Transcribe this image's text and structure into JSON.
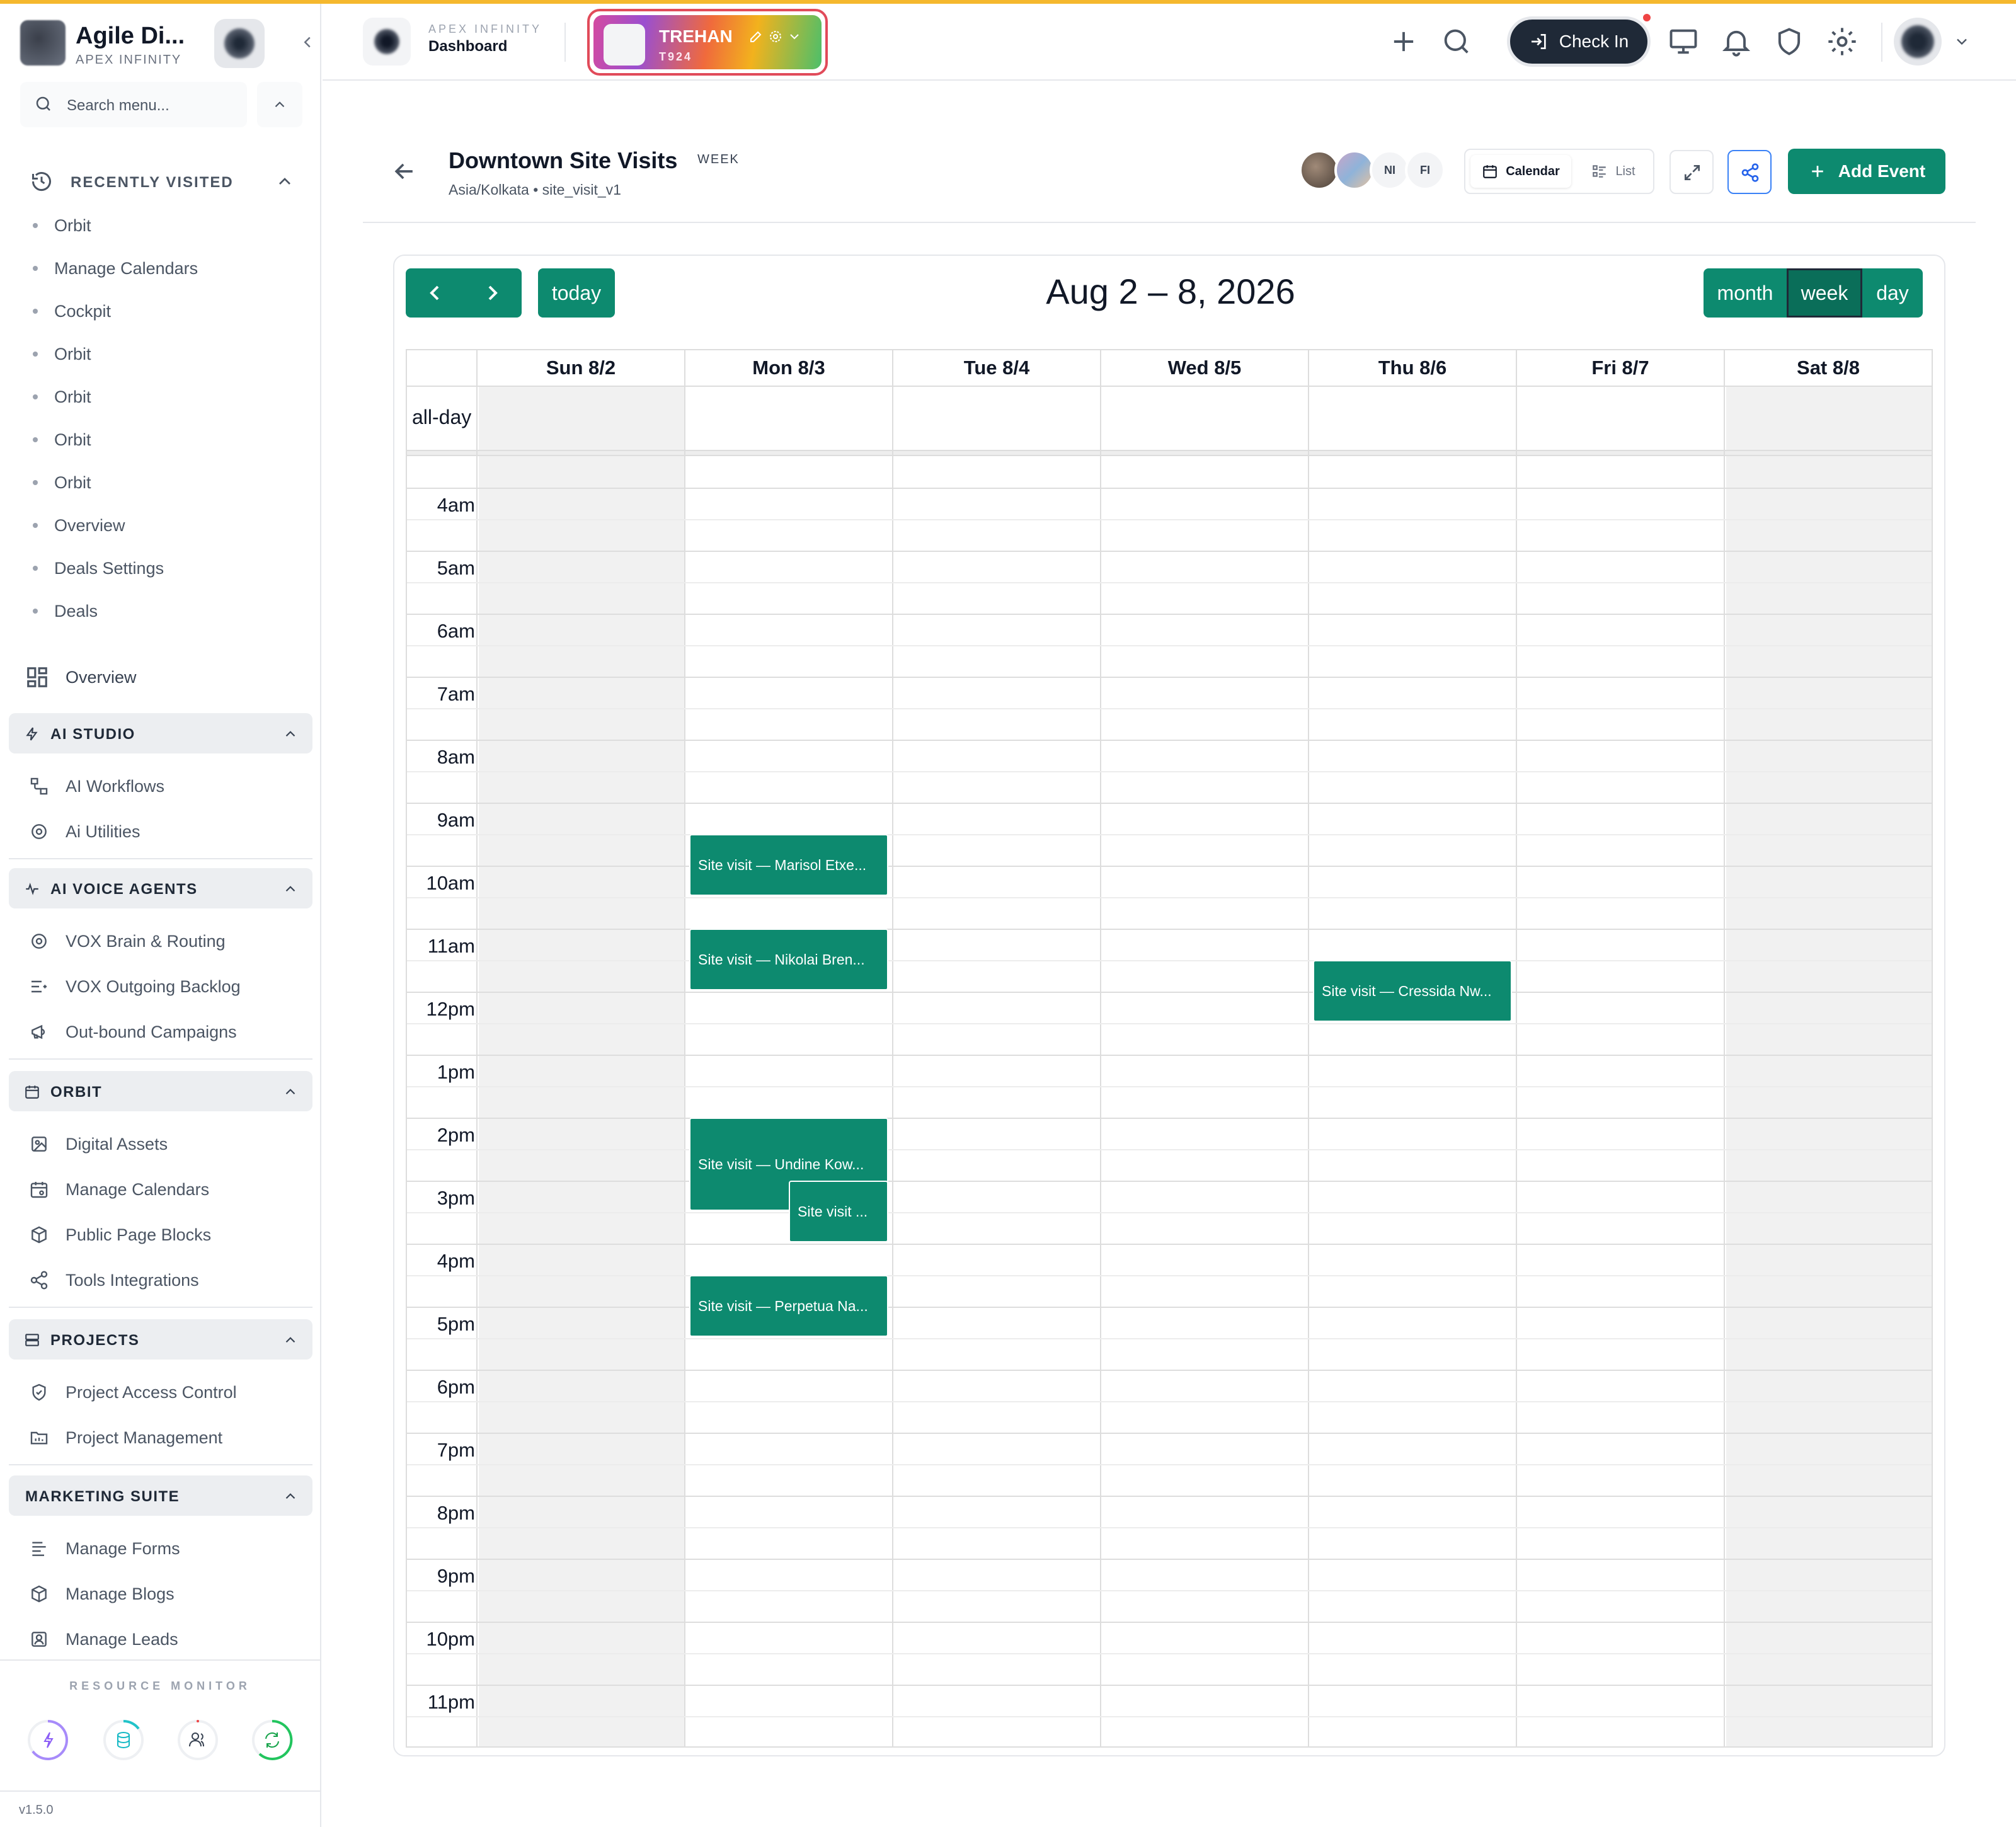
{
  "sidebar": {
    "brand_name": "Agile Di...",
    "brand_sub": "APEX INFINITY",
    "search_placeholder": "Search menu...",
    "recently_visited_label": "RECENTLY VISITED",
    "recently_visited": [
      "Orbit",
      "Manage Calendars",
      "Cockpit",
      "Orbit",
      "Orbit",
      "Orbit",
      "Orbit",
      "Overview",
      "Deals Settings",
      "Deals"
    ],
    "overview_label": "Overview",
    "groups": [
      {
        "label": "AI STUDIO",
        "items": [
          "AI Workflows",
          "Ai Utilities"
        ]
      },
      {
        "label": "AI VOICE AGENTS",
        "items": [
          "VOX Brain & Routing",
          "VOX Outgoing Backlog",
          "Out-bound Campaigns"
        ]
      },
      {
        "label": "ORBIT",
        "items": [
          "Digital Assets",
          "Manage Calendars",
          "Public Page Blocks",
          "Tools Integrations"
        ]
      },
      {
        "label": "PROJECTS",
        "items": [
          "Project Access Control",
          "Project Management"
        ]
      },
      {
        "label": "MARKETING SUITE",
        "items": [
          "Manage Forms",
          "Manage Blogs",
          "Manage Leads"
        ]
      }
    ],
    "resource_monitor_label": "RESOURCE MONITOR",
    "version": "v1.5.0"
  },
  "header": {
    "workspace_sub": "APEX INFINITY",
    "workspace_title": "Dashboard",
    "tenant_name": "TREHAN",
    "tenant_code": "T924",
    "check_in_label": "Check In"
  },
  "page": {
    "title": "Downtown Site Visits",
    "badge": "WEEK",
    "subtitle": "Asia/Kolkata • site_visit_v1",
    "avatar_initials": [
      "NI",
      "FI"
    ],
    "view_calendar_label": "Calendar",
    "view_list_label": "List",
    "add_event_label": "Add Event"
  },
  "calendar": {
    "today_label": "today",
    "title": "Aug 2 – 8, 2026",
    "views": [
      "month",
      "week",
      "day"
    ],
    "active_view": "week",
    "allday_label": "all-day",
    "days": [
      "Sun 8/2",
      "Mon 8/3",
      "Tue 8/4",
      "Wed 8/5",
      "Thu 8/6",
      "Fri 8/7",
      "Sat 8/8"
    ],
    "hours": [
      "4am",
      "5am",
      "6am",
      "7am",
      "8am",
      "9am",
      "10am",
      "11am",
      "12pm",
      "1pm",
      "2pm",
      "3pm",
      "4pm",
      "5pm",
      "6pm",
      "7pm",
      "8pm",
      "9pm",
      "10pm",
      "11pm"
    ],
    "events": [
      {
        "title": "Site visit — Marisol Etxe...",
        "day": 1,
        "start": 9.5,
        "end": 10.5
      },
      {
        "title": "Site visit — Nikolai Bren...",
        "day": 1,
        "start": 11.0,
        "end": 12.0
      },
      {
        "title": "Site visit — Cressida Nw...",
        "day": 4,
        "start": 11.5,
        "end": 12.5
      },
      {
        "title": "Site visit — Undine Kow...",
        "day": 1,
        "start": 14.0,
        "end": 15.5
      },
      {
        "title": "Site visit ...",
        "day": 1,
        "start": 15.0,
        "end": 16.0,
        "overlap": true
      },
      {
        "title": "Site visit — Perpetua Na...",
        "day": 1,
        "start": 16.5,
        "end": 17.5
      }
    ]
  }
}
